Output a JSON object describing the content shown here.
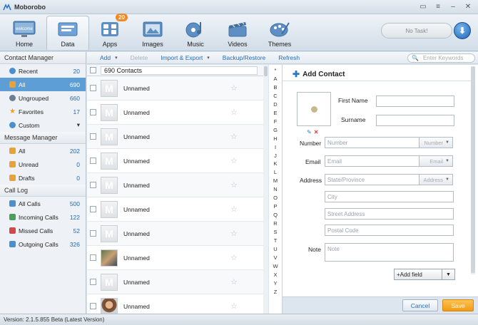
{
  "window": {
    "title": "Moborobo",
    "controls": [
      "chat-icon",
      "menu-icon",
      "minimize-icon",
      "close-icon"
    ]
  },
  "nav": {
    "items": [
      {
        "label": "Home",
        "icon": "welcome-monitor-icon",
        "thumb_text": "welcome"
      },
      {
        "label": "Data",
        "icon": "data-folder-icon",
        "active": true
      },
      {
        "label": "Apps",
        "icon": "apps-grid-icon",
        "badge": "20"
      },
      {
        "label": "Images",
        "icon": "images-icon"
      },
      {
        "label": "Music",
        "icon": "music-icon"
      },
      {
        "label": "Videos",
        "icon": "videos-clapper-icon"
      },
      {
        "label": "Themes",
        "icon": "themes-palette-icon"
      }
    ],
    "task_status": "No Task!",
    "download_icon": "download-icon"
  },
  "sidebar": {
    "contact_manager": {
      "title": "Contact Manager",
      "items": [
        {
          "label": "Recent",
          "count": "20",
          "icon": "recent-icon"
        },
        {
          "label": "All",
          "count": "690",
          "icon": "all-contacts-icon",
          "selected": true
        },
        {
          "label": "Ungrouped",
          "count": "660",
          "icon": "ungrouped-icon"
        },
        {
          "label": "Favorites",
          "count": "17",
          "icon": "star-icon"
        },
        {
          "label": "Custom",
          "count": "▾",
          "icon": "custom-group-icon"
        }
      ]
    },
    "message_manager": {
      "title": "Message Manager",
      "items": [
        {
          "label": "All",
          "count": "202",
          "icon": "messages-icon"
        },
        {
          "label": "Unread",
          "count": "0",
          "icon": "unread-icon"
        },
        {
          "label": "Drafts",
          "count": "0",
          "icon": "drafts-icon"
        }
      ]
    },
    "call_log": {
      "title": "Call Log",
      "items": [
        {
          "label": "All Calls",
          "count": "500",
          "icon": "all-calls-icon"
        },
        {
          "label": "Incoming Calls",
          "count": "122",
          "icon": "incoming-calls-icon"
        },
        {
          "label": "Missed Calls",
          "count": "52",
          "icon": "missed-calls-icon"
        },
        {
          "label": "Outgoing Calls",
          "count": "326",
          "icon": "outgoing-calls-icon"
        }
      ]
    }
  },
  "actions": {
    "add": "Add",
    "delete": "Delete",
    "import_export": "Import & Export",
    "backup_restore": "Backup/Restore",
    "refresh": "Refresh",
    "search_placeholder": "Enter Keywords"
  },
  "contacts": {
    "header": "690 Contacts",
    "rows": [
      {
        "name": "Unnamed",
        "avatar": "default"
      },
      {
        "name": "Unnamed",
        "avatar": "default"
      },
      {
        "name": "Unnamed",
        "avatar": "default"
      },
      {
        "name": "Unnamed",
        "avatar": "default"
      },
      {
        "name": "Unnamed",
        "avatar": "default"
      },
      {
        "name": "Unnamed",
        "avatar": "default"
      },
      {
        "name": "Unnamed",
        "avatar": "default"
      },
      {
        "name": "Unnamed",
        "avatar": "photo1"
      },
      {
        "name": "Unnamed",
        "avatar": "default"
      },
      {
        "name": "Unnamed",
        "avatar": "photo2"
      }
    ]
  },
  "alphabet": [
    "*",
    "A",
    "B",
    "C",
    "D",
    "E",
    "F",
    "G",
    "H",
    "I",
    "J",
    "K",
    "L",
    "M",
    "N",
    "O",
    "P",
    "Q",
    "R",
    "S",
    "T",
    "U",
    "V",
    "W",
    "X",
    "Y",
    "Z"
  ],
  "add_contact": {
    "title": "Add Contact",
    "first_name_label": "First Name",
    "surname_label": "Surname",
    "number_label": "Number",
    "number_placeholder": "Number",
    "number_type": "Number",
    "email_label": "Email",
    "email_placeholder": "Email",
    "email_type": "Email",
    "address_label": "Address",
    "state_placeholder": "State/Province",
    "address_type": "Address",
    "city_placeholder": "City",
    "street_placeholder": "Street Address",
    "postal_placeholder": "Postal Code",
    "note_label": "Note",
    "note_placeholder": "Note",
    "add_field": "+Add field",
    "cancel": "Cancel",
    "save": "Save"
  },
  "status": {
    "version": "Version: 2.1.5.855 Beta  (Latest Version)"
  },
  "colors": {
    "accent": "#5e9ed6",
    "link": "#2a6db5",
    "badge": "#f0892b",
    "save": "#f29b13"
  }
}
